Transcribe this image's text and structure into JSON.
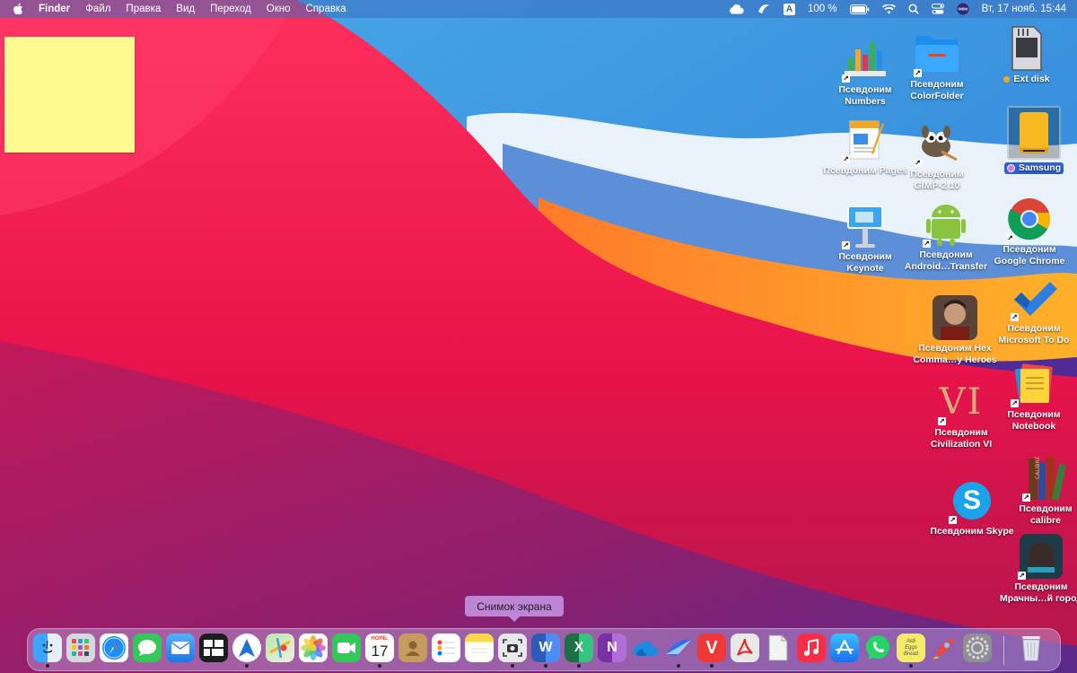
{
  "menubar": {
    "apple": "",
    "items": [
      "Finder",
      "Файл",
      "Правка",
      "Вид",
      "Переход",
      "Окно",
      "Справка"
    ],
    "battery": "100 %",
    "input_source": "A",
    "datetime": "Вт, 17 нояб.  15:44"
  },
  "desktop_icons": [
    {
      "label1": "Псевдоним",
      "label2": "Numbers",
      "icon": "numbers-icon"
    },
    {
      "label1": "Псевдоним",
      "label2": "ColorFolder",
      "icon": "folder-icon"
    },
    {
      "label1": "Ext disk",
      "label2": "",
      "icon": "sd-card-icon",
      "dot": "#f5a623"
    },
    {
      "label1": "Псевдоним Pages",
      "label2": "",
      "icon": "pages-icon"
    },
    {
      "label1": "Псевдоним",
      "label2": "GIMP-2.10",
      "icon": "gimp-icon"
    },
    {
      "label1": "Samsung",
      "label2": "",
      "icon": "external-drive-icon",
      "dot": "#c77cf0"
    },
    {
      "label1": "Псевдоним",
      "label2": "Keynote",
      "icon": "keynote-icon"
    },
    {
      "label1": "Псевдоним",
      "label2": "Android…Transfer",
      "icon": "android-icon"
    },
    {
      "label1": "Псевдоним",
      "label2": "Google Chrome",
      "icon": "chrome-icon"
    },
    {
      "label1": "Псевдоним Hex",
      "label2": "Comma…y Heroes",
      "icon": "game-hero-icon"
    },
    {
      "label1": "Псевдоним",
      "label2": "Microsoft To Do",
      "icon": "todo-icon"
    },
    {
      "label1": "Псевдоним",
      "label2": "Civilization VI",
      "icon": "civilization-icon",
      "glyph": "VI"
    },
    {
      "label1": "Псевдоним",
      "label2": "Notebook",
      "icon": "notebook-icon"
    },
    {
      "label1": "Псевдоним",
      "label2": "calibre",
      "icon": "calibre-icon",
      "glyph": "CALIBRE"
    },
    {
      "label1": "Псевдоним Skype",
      "label2": "",
      "icon": "skype-icon",
      "glyph": "S"
    },
    {
      "label1": "Псевдоним",
      "label2": "Мрачны…й город",
      "icon": "game-city-icon"
    }
  ],
  "tooltip": "Снимок экрана",
  "dock": {
    "calendar_month": "НОЯБ.",
    "calendar_day": "17",
    "word_glyph": "W",
    "excel_glyph": "X",
    "onenote_glyph": "N",
    "vivaldi_glyph": "V",
    "notes_text": "Aldi Eggs Bread",
    "items": [
      {
        "icon": "finder-icon",
        "color": "#3a8ef0",
        "running": true
      },
      {
        "icon": "launchpad-icon",
        "color": "#9aa3b5",
        "running": false
      },
      {
        "icon": "safari-icon",
        "color": "#2f8df5",
        "running": false
      },
      {
        "icon": "messages-icon",
        "color": "#34c759",
        "running": false
      },
      {
        "icon": "mail-icon",
        "color": "#3b95f7",
        "running": false
      },
      {
        "icon": "mission-control-icon",
        "color": "#1d1d1f",
        "running": false
      },
      {
        "icon": "send-icon",
        "color": "#1f6fd8",
        "running": true
      },
      {
        "icon": "maps-icon",
        "color": "#5cc160",
        "running": false
      },
      {
        "icon": "photos-icon",
        "color": "#ffffff",
        "running": false
      },
      {
        "icon": "facetime-icon",
        "color": "#34c759",
        "running": false
      },
      {
        "icon": "calendar-icon",
        "color": "#ffffff",
        "running": true
      },
      {
        "icon": "contacts-icon",
        "color": "#c79a5d",
        "running": false
      },
      {
        "icon": "reminders-icon",
        "color": "#ffffff",
        "running": false
      },
      {
        "icon": "notes-icon",
        "color": "#ffd84a",
        "running": false
      },
      {
        "icon": "screenshot-icon",
        "color": "#e8e8ea",
        "running": true
      },
      {
        "icon": "word-icon",
        "color": "#2b5bb7",
        "running": true
      },
      {
        "icon": "excel-icon",
        "color": "#1d7044",
        "running": true
      },
      {
        "icon": "onenote-icon",
        "color": "#7b2fa5",
        "running": false
      },
      {
        "icon": "onedrive-icon",
        "color": "#1c8ae0",
        "running": false
      },
      {
        "icon": "airmail-icon",
        "color": "#2a6df0",
        "running": true
      },
      {
        "icon": "vivaldi-icon",
        "color": "#ef3939",
        "running": true
      },
      {
        "icon": "acrobat-icon",
        "color": "#e8e8e8",
        "running": false
      },
      {
        "icon": "document-icon",
        "color": "#f2f2f2",
        "running": false
      },
      {
        "icon": "music-icon",
        "color": "#fa2d48",
        "running": false
      },
      {
        "icon": "app-store-icon",
        "color": "#1a8cf5",
        "running": false
      },
      {
        "icon": "whatsapp-icon",
        "color": "#25d366",
        "running": false
      },
      {
        "icon": "stickies-icon",
        "color": "#f7ea6a",
        "running": true
      },
      {
        "icon": "rocket-icon",
        "color": "#ff6a2a",
        "running": false
      },
      {
        "icon": "system-preferences-icon",
        "color": "#8e8e93",
        "running": false
      },
      {
        "icon": "trash-icon",
        "color": "transparent",
        "running": false
      }
    ]
  }
}
